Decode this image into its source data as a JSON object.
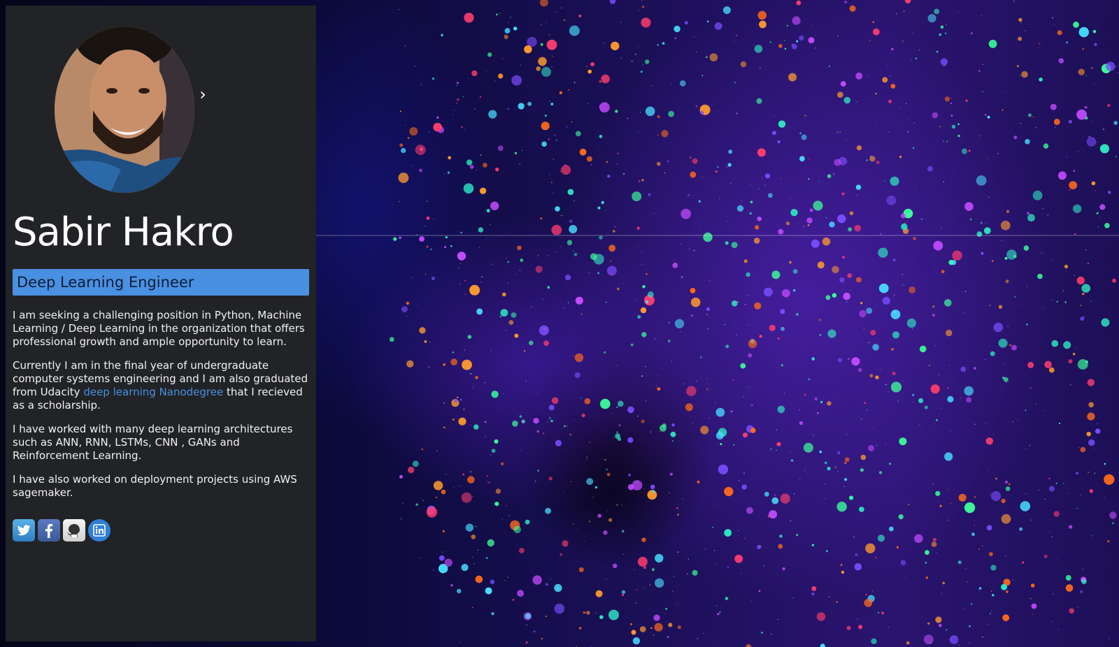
{
  "profile": {
    "name": "Sabir Hakro",
    "title": "Deep Learning Engineer",
    "carousel_next_glyph": "›"
  },
  "bio": {
    "p1": "I am seeking a challenging position in Python, Machine Learning / Deep Learning in the organization that offers professional growth and ample opportunity to learn.",
    "p2_before_link": "Currently I am in the final year of undergraduate computer systems engineering and I am also graduated from Udacity ",
    "p2_link": "deep learning Nanodegree",
    "p2_after_link": " that I recieved as a scholarship.",
    "p3": "I have worked with many deep learning architectures such as ANN, RNN, LSTMs, CNN , GANs and Reinforcement Learning.",
    "p4": "I have also worked on deployment projects using AWS sagemaker."
  },
  "social": [
    {
      "name": "twitter",
      "icon": "twitter-icon"
    },
    {
      "name": "facebook",
      "icon": "facebook-icon"
    },
    {
      "name": "github",
      "icon": "github-icon"
    },
    {
      "name": "linkedin",
      "icon": "linkedin-icon"
    }
  ],
  "colors": {
    "panel_bg": "#212326",
    "accent": "#4a90e2",
    "text": "#f2f2f2"
  }
}
